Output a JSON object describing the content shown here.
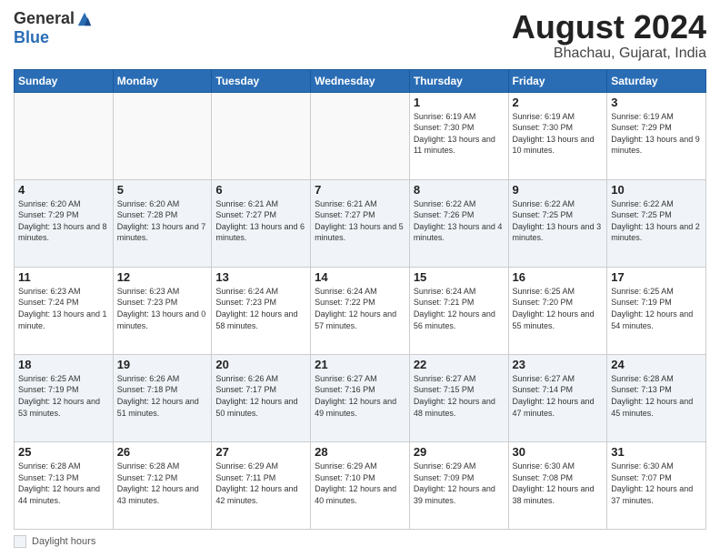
{
  "header": {
    "logo_general": "General",
    "logo_blue": "Blue",
    "month_year": "August 2024",
    "location": "Bhachau, Gujarat, India"
  },
  "days_of_week": [
    "Sunday",
    "Monday",
    "Tuesday",
    "Wednesday",
    "Thursday",
    "Friday",
    "Saturday"
  ],
  "footer": {
    "legend_label": "Daylight hours"
  },
  "weeks": [
    [
      {
        "day": "",
        "info": ""
      },
      {
        "day": "",
        "info": ""
      },
      {
        "day": "",
        "info": ""
      },
      {
        "day": "",
        "info": ""
      },
      {
        "day": "1",
        "info": "Sunrise: 6:19 AM\nSunset: 7:30 PM\nDaylight: 13 hours and 11 minutes."
      },
      {
        "day": "2",
        "info": "Sunrise: 6:19 AM\nSunset: 7:30 PM\nDaylight: 13 hours and 10 minutes."
      },
      {
        "day": "3",
        "info": "Sunrise: 6:19 AM\nSunset: 7:29 PM\nDaylight: 13 hours and 9 minutes."
      }
    ],
    [
      {
        "day": "4",
        "info": "Sunrise: 6:20 AM\nSunset: 7:29 PM\nDaylight: 13 hours and 8 minutes."
      },
      {
        "day": "5",
        "info": "Sunrise: 6:20 AM\nSunset: 7:28 PM\nDaylight: 13 hours and 7 minutes."
      },
      {
        "day": "6",
        "info": "Sunrise: 6:21 AM\nSunset: 7:27 PM\nDaylight: 13 hours and 6 minutes."
      },
      {
        "day": "7",
        "info": "Sunrise: 6:21 AM\nSunset: 7:27 PM\nDaylight: 13 hours and 5 minutes."
      },
      {
        "day": "8",
        "info": "Sunrise: 6:22 AM\nSunset: 7:26 PM\nDaylight: 13 hours and 4 minutes."
      },
      {
        "day": "9",
        "info": "Sunrise: 6:22 AM\nSunset: 7:25 PM\nDaylight: 13 hours and 3 minutes."
      },
      {
        "day": "10",
        "info": "Sunrise: 6:22 AM\nSunset: 7:25 PM\nDaylight: 13 hours and 2 minutes."
      }
    ],
    [
      {
        "day": "11",
        "info": "Sunrise: 6:23 AM\nSunset: 7:24 PM\nDaylight: 13 hours and 1 minute."
      },
      {
        "day": "12",
        "info": "Sunrise: 6:23 AM\nSunset: 7:23 PM\nDaylight: 13 hours and 0 minutes."
      },
      {
        "day": "13",
        "info": "Sunrise: 6:24 AM\nSunset: 7:23 PM\nDaylight: 12 hours and 58 minutes."
      },
      {
        "day": "14",
        "info": "Sunrise: 6:24 AM\nSunset: 7:22 PM\nDaylight: 12 hours and 57 minutes."
      },
      {
        "day": "15",
        "info": "Sunrise: 6:24 AM\nSunset: 7:21 PM\nDaylight: 12 hours and 56 minutes."
      },
      {
        "day": "16",
        "info": "Sunrise: 6:25 AM\nSunset: 7:20 PM\nDaylight: 12 hours and 55 minutes."
      },
      {
        "day": "17",
        "info": "Sunrise: 6:25 AM\nSunset: 7:19 PM\nDaylight: 12 hours and 54 minutes."
      }
    ],
    [
      {
        "day": "18",
        "info": "Sunrise: 6:25 AM\nSunset: 7:19 PM\nDaylight: 12 hours and 53 minutes."
      },
      {
        "day": "19",
        "info": "Sunrise: 6:26 AM\nSunset: 7:18 PM\nDaylight: 12 hours and 51 minutes."
      },
      {
        "day": "20",
        "info": "Sunrise: 6:26 AM\nSunset: 7:17 PM\nDaylight: 12 hours and 50 minutes."
      },
      {
        "day": "21",
        "info": "Sunrise: 6:27 AM\nSunset: 7:16 PM\nDaylight: 12 hours and 49 minutes."
      },
      {
        "day": "22",
        "info": "Sunrise: 6:27 AM\nSunset: 7:15 PM\nDaylight: 12 hours and 48 minutes."
      },
      {
        "day": "23",
        "info": "Sunrise: 6:27 AM\nSunset: 7:14 PM\nDaylight: 12 hours and 47 minutes."
      },
      {
        "day": "24",
        "info": "Sunrise: 6:28 AM\nSunset: 7:13 PM\nDaylight: 12 hours and 45 minutes."
      }
    ],
    [
      {
        "day": "25",
        "info": "Sunrise: 6:28 AM\nSunset: 7:13 PM\nDaylight: 12 hours and 44 minutes."
      },
      {
        "day": "26",
        "info": "Sunrise: 6:28 AM\nSunset: 7:12 PM\nDaylight: 12 hours and 43 minutes."
      },
      {
        "day": "27",
        "info": "Sunrise: 6:29 AM\nSunset: 7:11 PM\nDaylight: 12 hours and 42 minutes."
      },
      {
        "day": "28",
        "info": "Sunrise: 6:29 AM\nSunset: 7:10 PM\nDaylight: 12 hours and 40 minutes."
      },
      {
        "day": "29",
        "info": "Sunrise: 6:29 AM\nSunset: 7:09 PM\nDaylight: 12 hours and 39 minutes."
      },
      {
        "day": "30",
        "info": "Sunrise: 6:30 AM\nSunset: 7:08 PM\nDaylight: 12 hours and 38 minutes."
      },
      {
        "day": "31",
        "info": "Sunrise: 6:30 AM\nSunset: 7:07 PM\nDaylight: 12 hours and 37 minutes."
      }
    ]
  ]
}
